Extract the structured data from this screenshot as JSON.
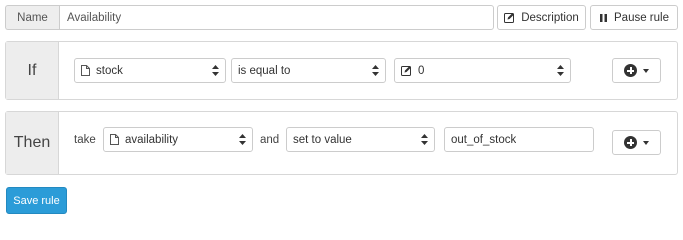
{
  "header": {
    "name_label": "Name",
    "name_value": "Availability",
    "description_label": "Description",
    "pause_label": "Pause rule"
  },
  "if_block": {
    "label": "If",
    "field": "stock",
    "operator": "is equal to",
    "value": "0"
  },
  "then_block": {
    "label": "Then",
    "take_label": "take",
    "field": "availability",
    "and_label": "and",
    "action": "set to value",
    "value": "out_of_stock"
  },
  "footer": {
    "save_label": "Save rule"
  },
  "colors": {
    "primary": "#2b9cd8",
    "addon_bg": "#eeeeee",
    "border": "#cccccc"
  },
  "icons": {
    "description": "edit-icon",
    "pause": "pause-icon",
    "field": "file-icon",
    "value": "edit-icon",
    "add": "plus-circle-icon"
  }
}
